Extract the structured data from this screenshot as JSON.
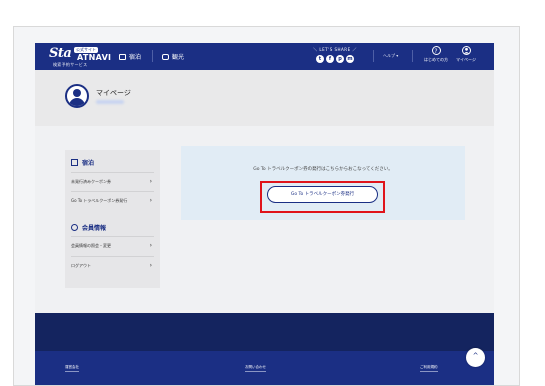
{
  "header": {
    "logo_script": "Sta",
    "logo_badge": "公式サイト",
    "logo_navi": "ATNAVI",
    "logo_sub": "検索予約サービス",
    "nav_stay": "宿泊",
    "nav_sightseeing": "観光",
    "share_label": "＼ LET'S SHARE ／",
    "share_icons": [
      "t",
      "f",
      "p",
      "m"
    ],
    "help": "ヘルプ ▾",
    "first_time_label": "はじめての方",
    "first_time_icon": "?",
    "mypage_label": "マイページ"
  },
  "profile": {
    "title": "マイページ"
  },
  "sidebar": {
    "stay_heading": "宿泊",
    "stay_items": [
      "未発行済みクーポン券",
      "Go To トラベルクーポン券発行"
    ],
    "member_heading": "会員情報",
    "member_items": [
      "会員情報の照会・変更",
      "ログアウト"
    ],
    "chevron": "›"
  },
  "main": {
    "message": "Go To トラベルクーポン券の発行はこちらからおこなってください。",
    "button_label": "Go To トラベルクーポン券発行"
  },
  "footer": {
    "links": [
      "運営会社",
      "お問い合わせ",
      "ご利用規約"
    ],
    "to_top": "^"
  },
  "colors": {
    "brand_navy": "#1b2f84",
    "highlight_red": "#e0141b",
    "card_bg": "#e1ecf5"
  }
}
